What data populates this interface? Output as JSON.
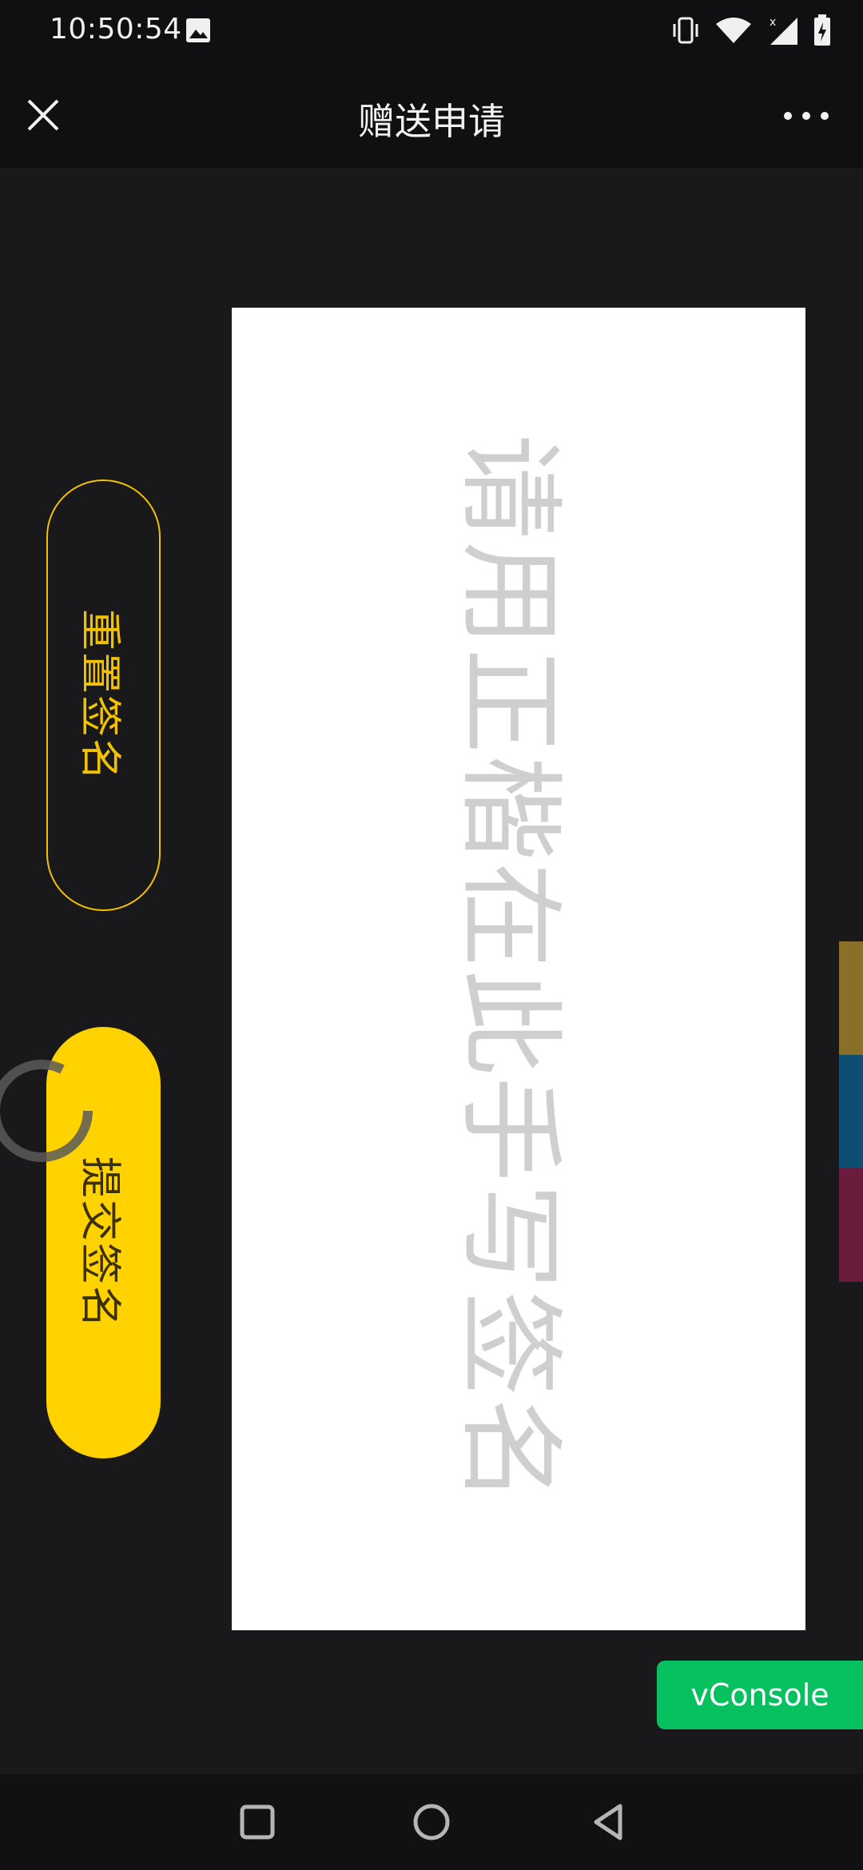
{
  "status_bar": {
    "time": "10:50:54",
    "icons": [
      "photo-icon",
      "vibrate-icon",
      "wifi-icon",
      "signal-icon",
      "battery-charging-icon"
    ]
  },
  "nav": {
    "title": "赠送申请",
    "close_icon": "close-icon",
    "more_icon": "more-icon"
  },
  "signature_pad": {
    "placeholder": "请用正楷在此手写签名"
  },
  "actions": {
    "reset_label": "重置签名",
    "submit_label": "提交签名"
  },
  "debug": {
    "vconsole_label": "vConsole"
  },
  "colors": {
    "accent": "#ffd200",
    "background": "#19191c",
    "pad": "#ffffff",
    "vconsole": "#07c160",
    "side_tabs": [
      "#8a6f28",
      "#0f4d73",
      "#6b1b3c"
    ]
  },
  "system_nav": [
    "recents-icon",
    "home-icon",
    "back-icon"
  ]
}
